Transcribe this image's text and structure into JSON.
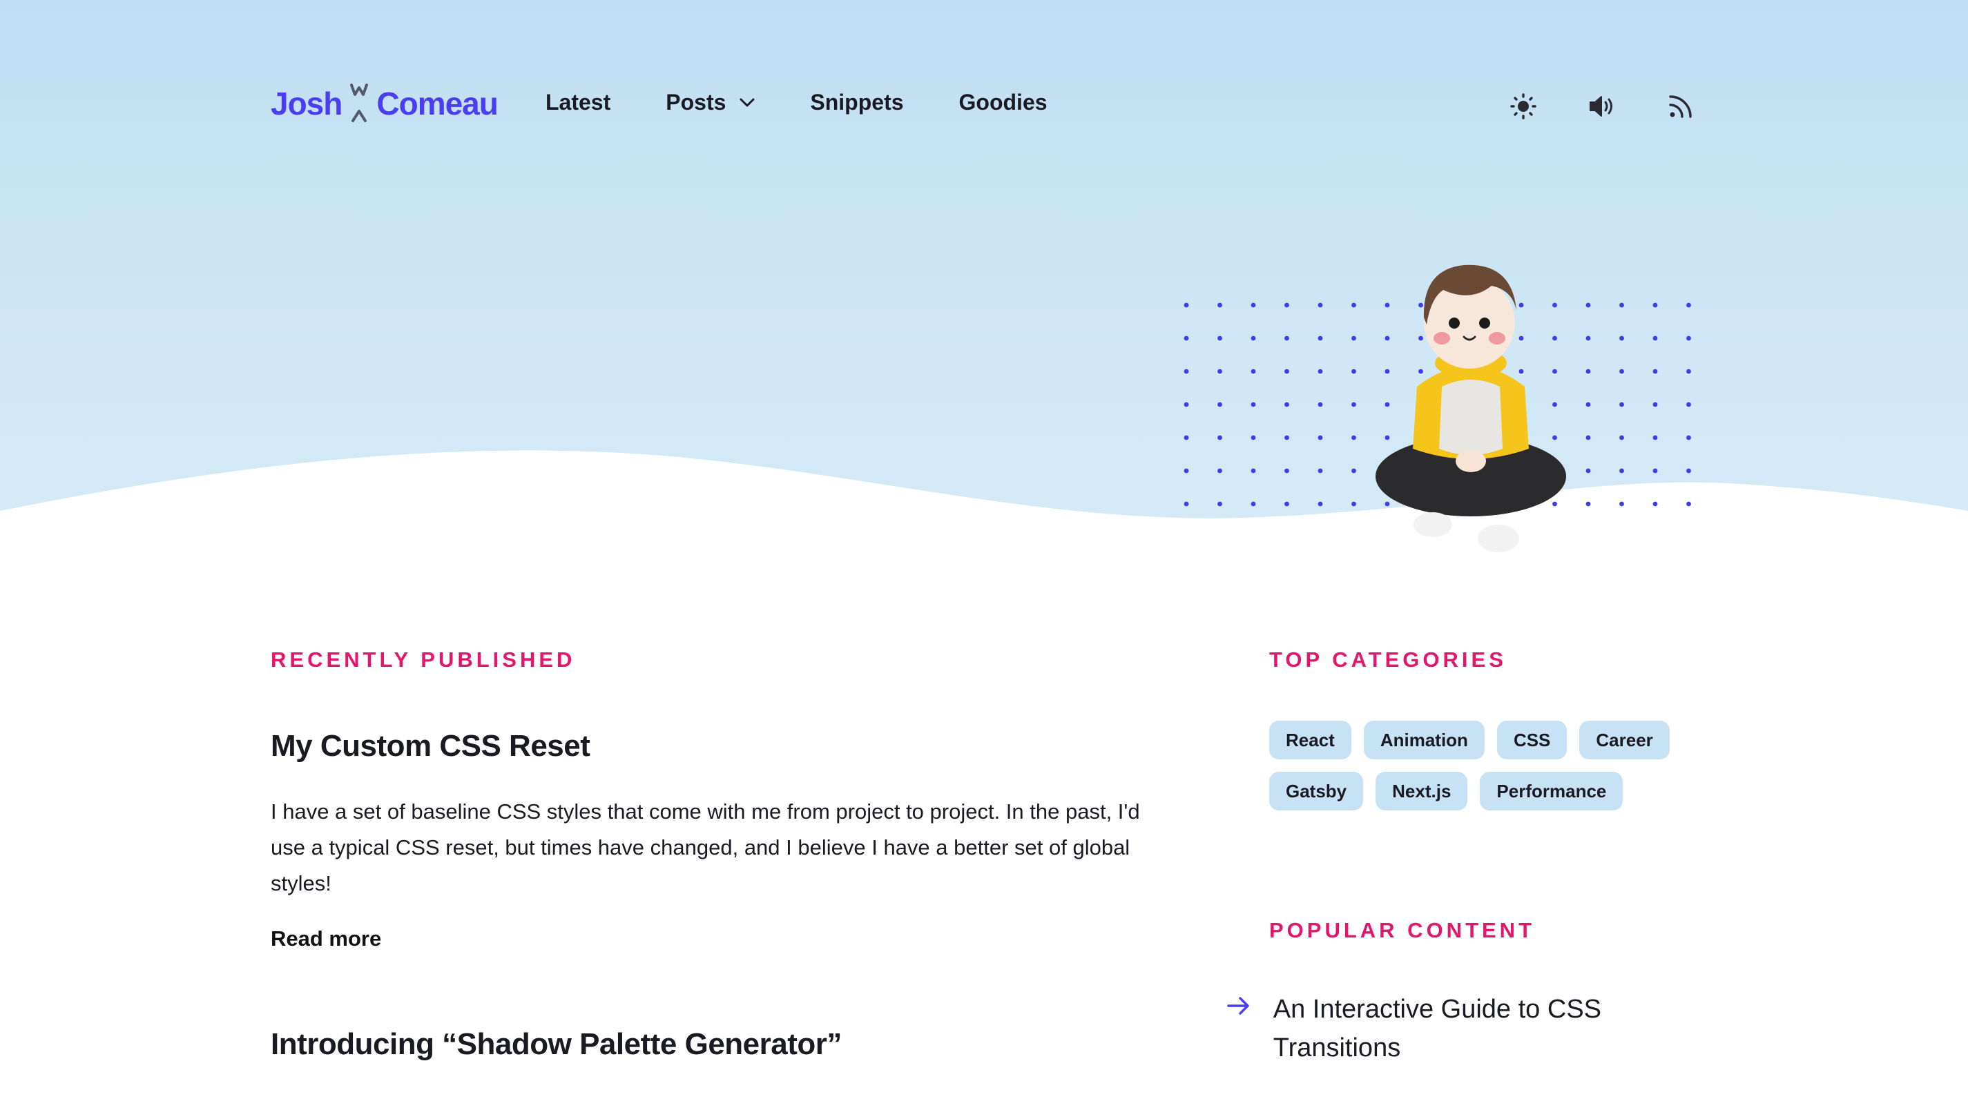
{
  "brand": {
    "first": "Josh",
    "last": "Comeau",
    "color": "#4a3ef0"
  },
  "nav": {
    "items": [
      {
        "label": "Latest"
      },
      {
        "label": "Posts",
        "has_dropdown": true
      },
      {
        "label": "Snippets"
      },
      {
        "label": "Goodies"
      }
    ]
  },
  "toolbar": {
    "icons": [
      "sun-icon",
      "volume-icon",
      "rss-icon"
    ]
  },
  "recent": {
    "heading": "RECENTLY PUBLISHED",
    "posts": [
      {
        "title": "My Custom CSS Reset",
        "excerpt": "I have a set of baseline CSS styles that come with me from project to project. In the past, I'd use a typical CSS reset, but times have changed, and I believe I have a better set of global styles!",
        "read_more": "Read more"
      },
      {
        "title": "Introducing “Shadow Palette Generator”"
      }
    ]
  },
  "sidebar": {
    "categories_heading": "TOP CATEGORIES",
    "categories": [
      "React",
      "Animation",
      "CSS",
      "Career",
      "Gatsby",
      "Next.js",
      "Performance"
    ],
    "popular_heading": "POPULAR CONTENT",
    "popular": [
      "An Interactive Guide to CSS Transitions"
    ]
  },
  "colors": {
    "accent_pink": "#e3156c",
    "hero_blue": "#c0dff3",
    "tag_bg": "#c6e2f4",
    "brand_purple": "#4a3ef0"
  }
}
